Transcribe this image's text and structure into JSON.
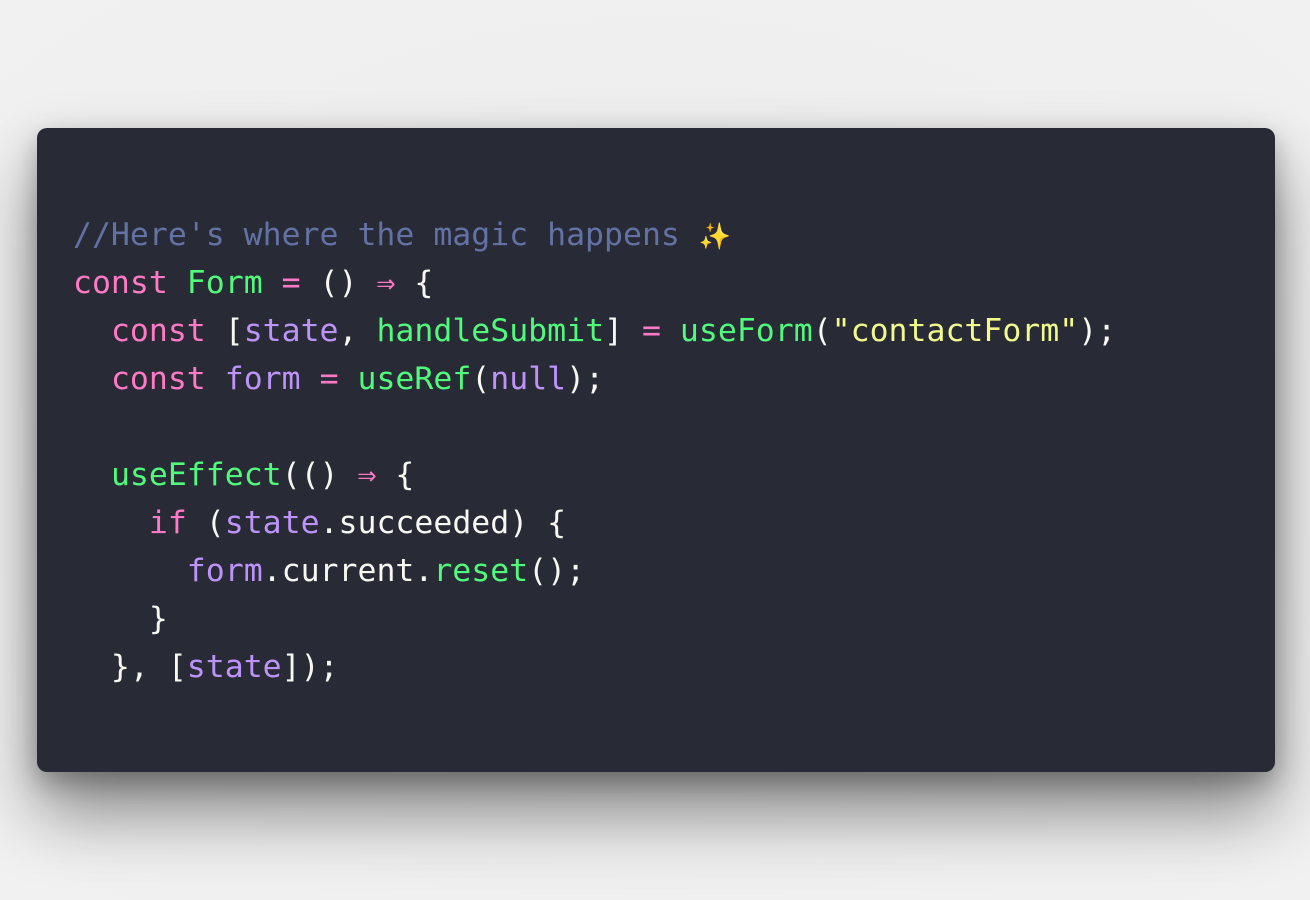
{
  "colors": {
    "background": "#ececec",
    "editor": "#282a36",
    "comment": "#6272a4",
    "keyword": "#ff79c6",
    "function": "#50fa7b",
    "variable": "#bd93f9",
    "string": "#f1fa8c",
    "plain": "#f8f8f2"
  },
  "code": {
    "lines": [
      [
        {
          "t": "//Here's where the magic happens ",
          "c": "comment",
          "n": "code-comment"
        },
        {
          "t": "✨",
          "c": "sparkle",
          "n": "sparkles-icon"
        }
      ],
      [
        {
          "t": "const",
          "c": "keyword",
          "n": "code-keyword"
        },
        {
          "t": " ",
          "c": "plain",
          "n": "code-space"
        },
        {
          "t": "Form",
          "c": "func",
          "n": "code-function-name"
        },
        {
          "t": " ",
          "c": "plain",
          "n": "code-space"
        },
        {
          "t": "=",
          "c": "keyword",
          "n": "code-operator"
        },
        {
          "t": " () ",
          "c": "plain",
          "n": "code-punctuation"
        },
        {
          "t": "⇒",
          "c": "keyword",
          "n": "code-arrow"
        },
        {
          "t": " {",
          "c": "plain",
          "n": "code-punctuation"
        }
      ],
      [
        {
          "t": "  ",
          "c": "plain",
          "n": "code-indent"
        },
        {
          "t": "const",
          "c": "keyword",
          "n": "code-keyword"
        },
        {
          "t": " [",
          "c": "plain",
          "n": "code-punctuation"
        },
        {
          "t": "state",
          "c": "variable",
          "n": "code-variable"
        },
        {
          "t": ", ",
          "c": "plain",
          "n": "code-punctuation"
        },
        {
          "t": "handleSubmit",
          "c": "func",
          "n": "code-function-name"
        },
        {
          "t": "] ",
          "c": "plain",
          "n": "code-punctuation"
        },
        {
          "t": "=",
          "c": "keyword",
          "n": "code-operator"
        },
        {
          "t": " ",
          "c": "plain",
          "n": "code-space"
        },
        {
          "t": "useForm",
          "c": "func",
          "n": "code-function-call"
        },
        {
          "t": "(",
          "c": "plain",
          "n": "code-punctuation"
        },
        {
          "t": "\"contactForm\"",
          "c": "string",
          "n": "code-string"
        },
        {
          "t": ");",
          "c": "plain",
          "n": "code-punctuation"
        }
      ],
      [
        {
          "t": "  ",
          "c": "plain",
          "n": "code-indent"
        },
        {
          "t": "const",
          "c": "keyword",
          "n": "code-keyword"
        },
        {
          "t": " ",
          "c": "plain",
          "n": "code-space"
        },
        {
          "t": "form",
          "c": "variable",
          "n": "code-variable"
        },
        {
          "t": " ",
          "c": "plain",
          "n": "code-space"
        },
        {
          "t": "=",
          "c": "keyword",
          "n": "code-operator"
        },
        {
          "t": " ",
          "c": "plain",
          "n": "code-space"
        },
        {
          "t": "useRef",
          "c": "func",
          "n": "code-function-call"
        },
        {
          "t": "(",
          "c": "plain",
          "n": "code-punctuation"
        },
        {
          "t": "null",
          "c": "variable",
          "n": "code-constant"
        },
        {
          "t": ");",
          "c": "plain",
          "n": "code-punctuation"
        }
      ],
      [],
      [
        {
          "t": "  ",
          "c": "plain",
          "n": "code-indent"
        },
        {
          "t": "useEffect",
          "c": "func",
          "n": "code-function-call"
        },
        {
          "t": "(() ",
          "c": "plain",
          "n": "code-punctuation"
        },
        {
          "t": "⇒",
          "c": "keyword",
          "n": "code-arrow"
        },
        {
          "t": " {",
          "c": "plain",
          "n": "code-punctuation"
        }
      ],
      [
        {
          "t": "    ",
          "c": "plain",
          "n": "code-indent"
        },
        {
          "t": "if",
          "c": "keyword",
          "n": "code-keyword"
        },
        {
          "t": " (",
          "c": "plain",
          "n": "code-punctuation"
        },
        {
          "t": "state",
          "c": "variable",
          "n": "code-variable"
        },
        {
          "t": ".succeeded) {",
          "c": "plain",
          "n": "code-property"
        }
      ],
      [
        {
          "t": "      ",
          "c": "plain",
          "n": "code-indent"
        },
        {
          "t": "form",
          "c": "variable",
          "n": "code-variable"
        },
        {
          "t": ".current.",
          "c": "plain",
          "n": "code-property"
        },
        {
          "t": "reset",
          "c": "func",
          "n": "code-function-call"
        },
        {
          "t": "();",
          "c": "plain",
          "n": "code-punctuation"
        }
      ],
      [
        {
          "t": "    }",
          "c": "plain",
          "n": "code-punctuation"
        }
      ],
      [
        {
          "t": "  }, [",
          "c": "plain",
          "n": "code-punctuation"
        },
        {
          "t": "state",
          "c": "variable",
          "n": "code-variable"
        },
        {
          "t": "]);",
          "c": "plain",
          "n": "code-punctuation"
        }
      ]
    ]
  }
}
